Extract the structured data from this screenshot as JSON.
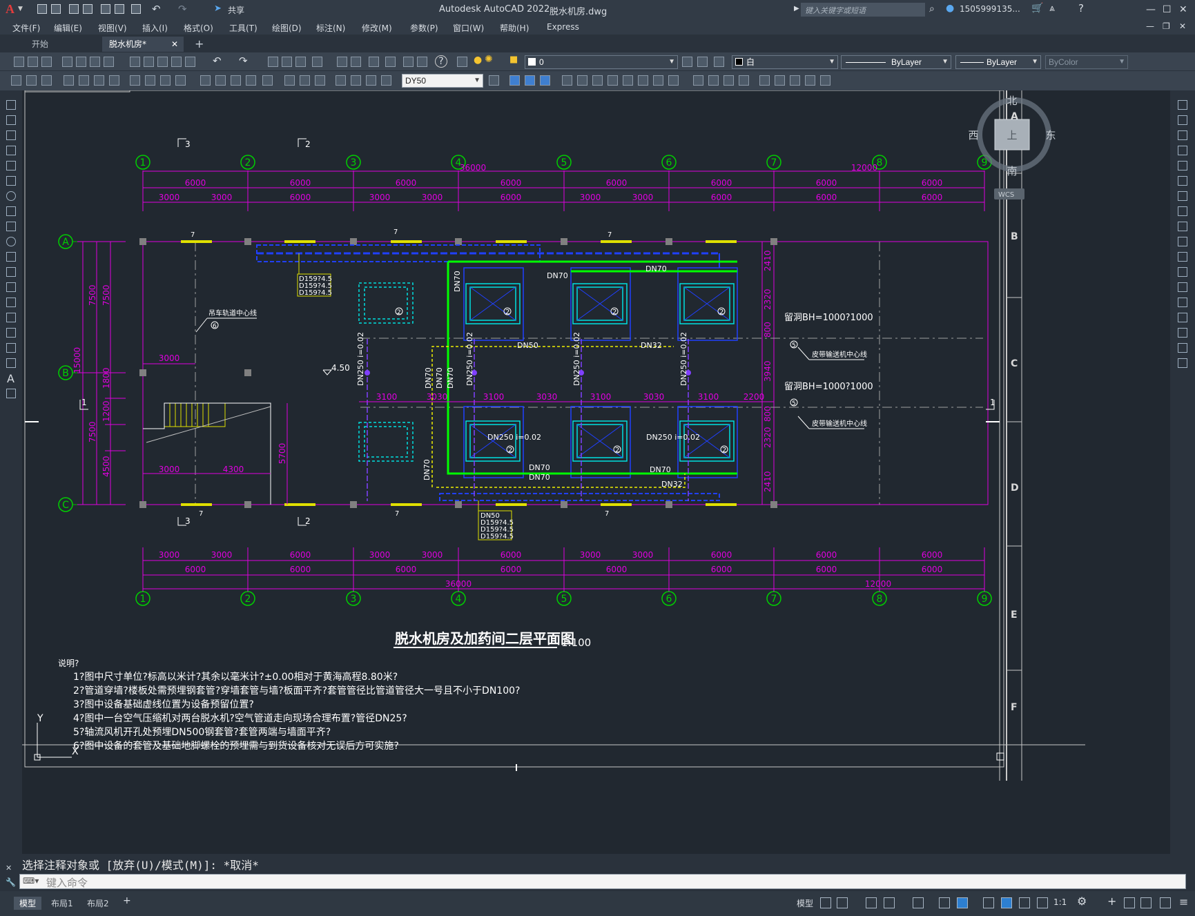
{
  "titlebar": {
    "app_title": "Autodesk AutoCAD 2022",
    "file_name": "脱水机房.dwg",
    "share_label": "共享",
    "search_placeholder": "键入关键字或短语",
    "user": "1505999135...",
    "logo": "A"
  },
  "menubar": {
    "items": [
      "文件(F)",
      "编辑(E)",
      "视图(V)",
      "插入(I)",
      "格式(O)",
      "工具(T)",
      "绘图(D)",
      "标注(N)",
      "修改(M)",
      "参数(P)",
      "窗口(W)",
      "帮助(H)",
      "Express"
    ]
  },
  "tabs": {
    "start": "开始",
    "active": "脱水机房*"
  },
  "toolbar": {
    "layer_value": "0",
    "color_value": "白",
    "linetype_value": "ByLayer",
    "lineweight_value": "ByLayer",
    "plotstyle_value": "ByColor",
    "dimstyle_value": "DY50"
  },
  "drawing": {
    "axis_columns": [
      "1",
      "2",
      "3",
      "4",
      "5",
      "6",
      "7",
      "8",
      "9"
    ],
    "axis_rows": [
      "A",
      "B",
      "C"
    ],
    "dims_top1": [
      "6000",
      "6000",
      "6000",
      "6000",
      "6000",
      "6000",
      "6000",
      "6000"
    ],
    "dims_top2": [
      "3000",
      "3000",
      "6000",
      "3000",
      "3000",
      "6000",
      "3000",
      "3000",
      "6000",
      "6000",
      "6000"
    ],
    "dim_total": "36000",
    "dim_12000": "12000",
    "dims_left": [
      "7500",
      "7500",
      "15000",
      "1800",
      "1200",
      "7500",
      "4500"
    ],
    "pipe_labels": [
      "DN70",
      "DN70",
      "DN70",
      "DN50",
      "DN32",
      "DN250 i=0.02",
      "DN250 i=0.02",
      "DN250 i=0.02",
      "DN250 i=0.02",
      "DN70",
      "DN70",
      "DN70",
      "DN70",
      "DN32",
      "DN70",
      "DN70",
      "DN250 i=0.02",
      "DN250 i=0.02",
      "DN70"
    ],
    "dims_mid": [
      "3100",
      "3030",
      "3100",
      "3030",
      "3100",
      "3030",
      "3100",
      "2200"
    ],
    "dims_right": [
      "2410",
      "2320",
      "800",
      "3940",
      "800",
      "2320",
      "2410"
    ],
    "box_labels_top": [
      "D159?4.5",
      "D159?4.5",
      "D159?4.5"
    ],
    "box_labels_bottom": [
      "DN50",
      "D159?4.5",
      "D159?4.5",
      "D159?4.5"
    ],
    "note_crane": "吊车轨道中心线",
    "level": "4.50",
    "dim_3000": "3000",
    "dim_4300": "4300",
    "dim_5700": "5700",
    "hole_1": "留洞BH=1000?1000",
    "hole_2": "留洞BH=1000?1000",
    "conveyor_1": "皮带输送机中心线",
    "conveyor_2": "皮带输送机中心线",
    "title": "脱水机房及加药间二层平面图",
    "scale": "1:100",
    "notes_title": "说明?",
    "notes": [
      "1?图中尺寸单位?标高以米计?其余以毫米计?±0.00相对于黄海高程8.80米?",
      "2?管道穿墙?楼板处需预埋钢套管?穿墙套管与墙?板面平齐?套管管径比管道管径大一号且不小于DN100?",
      "3?图中设备基础虚线位置为设备预留位置?",
      "4?图中一台空气压缩机对两台脱水机?空气管道走向现场合理布置?管径DN25?",
      "5?轴流风机开孔处预埋DN500钢套管?套管两端与墙面平齐?",
      "6?图中设备的套管及基础地脚螺栓的预埋需与到货设备核对无误后方可实施?"
    ],
    "section_marks": [
      "1",
      "1",
      "2",
      "2",
      "3",
      "3"
    ],
    "equip_num": "2",
    "ref_5": "5",
    "ref_6": "6",
    "ref_7": "7",
    "row_letters_right": [
      "A",
      "B",
      "C",
      "D",
      "E",
      "F"
    ]
  },
  "viewcube": {
    "north": "北",
    "south": "南",
    "east": "东",
    "west": "西",
    "top": "上",
    "wcs": "WCS"
  },
  "ucs": {
    "y": "Y",
    "x": "X"
  },
  "command": {
    "history": "选择注释对象或 [放弃(U)/模式(M)]: *取消*",
    "placeholder": "键入命令"
  },
  "statusbar": {
    "tabs": [
      "模型",
      "布局1",
      "布局2"
    ],
    "model_label": "模型",
    "scale": "1:1"
  }
}
